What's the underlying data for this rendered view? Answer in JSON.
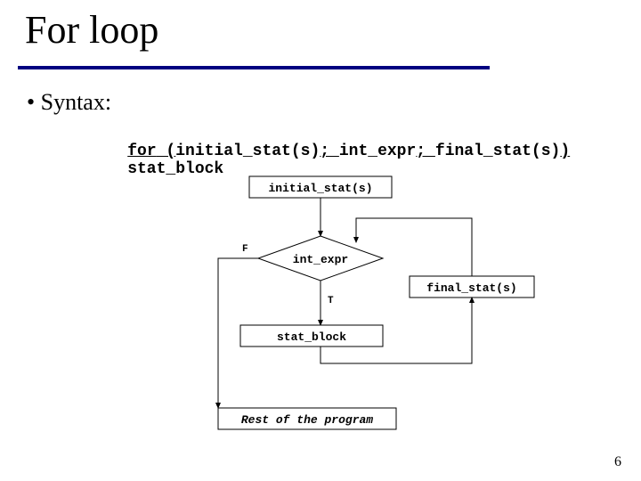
{
  "title": "For loop",
  "bullet": "• Syntax:",
  "syntax": {
    "kw_for": "for",
    "lparen": " (",
    "init": "initial_stat(s)",
    "semi1": "; ",
    "cond": "int_expr",
    "semi2": "; ",
    "final": "final_stat(s)",
    "rparen": ")",
    "body": "    stat_block"
  },
  "chart_data": {
    "type": "diagram",
    "title": "For loop flowchart",
    "nodes": [
      {
        "id": "init",
        "shape": "rect",
        "label": "initial_stat(s)"
      },
      {
        "id": "cond",
        "shape": "diamond",
        "label": "int_expr"
      },
      {
        "id": "body",
        "shape": "rect",
        "label": "stat_block"
      },
      {
        "id": "final",
        "shape": "rect",
        "label": "final_stat(s)"
      },
      {
        "id": "rest",
        "shape": "rect",
        "label": "Rest of the program",
        "italic": true
      }
    ],
    "edges": [
      {
        "from": "init",
        "to": "cond"
      },
      {
        "from": "cond",
        "to": "body",
        "label": "T"
      },
      {
        "from": "body",
        "to": "final"
      },
      {
        "from": "final",
        "to": "cond"
      },
      {
        "from": "cond",
        "to": "rest",
        "label": "F"
      }
    ]
  },
  "labels": {
    "T": "T",
    "F": "F"
  },
  "pagenum": "6"
}
